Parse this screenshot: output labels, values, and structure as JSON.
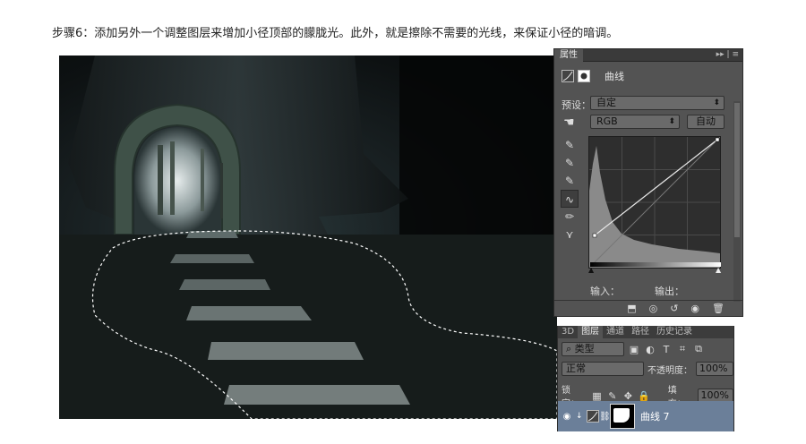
{
  "caption": "步骤6：添加另外一个调整图层来增加小径顶部的朦胧光。此外，就是擦除不需要的光线，来保证小径的暗调。",
  "properties_panel": {
    "tab": "属性",
    "adjustment_title": "曲线",
    "preset_label": "预设：",
    "preset_value": "自定",
    "channel_value": "RGB",
    "auto_button": "自动",
    "input_label": "输入：",
    "output_label": "输出："
  },
  "layers_panel": {
    "tabs": [
      "3D",
      "图层",
      "通道",
      "路径",
      "历史记录"
    ],
    "active_tab": "图层",
    "filter_kind": "类型",
    "blend_mode": "正常",
    "opacity_label": "不透明度：",
    "opacity_value": "100%",
    "lock_label": "锁定：",
    "fill_label": "填充：",
    "fill_value": "100%",
    "layer_name": "曲线 7"
  },
  "colors": {
    "panel_bg": "#535353",
    "selected_layer": "#6b7f99"
  }
}
